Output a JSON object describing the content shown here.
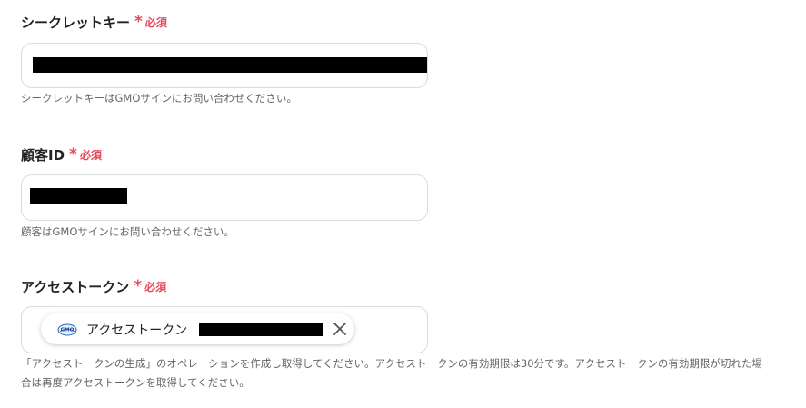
{
  "required_text": "必須",
  "required_marker": "*",
  "fields": {
    "secret_key": {
      "label": "シークレットキー",
      "value": "",
      "help": "シークレットキーはGMOサインにお問い合わせください。"
    },
    "customer_id": {
      "label": "顧客ID",
      "value": "",
      "help": "顧客はGMOサインにお問い合わせください。"
    },
    "access_token": {
      "label": "アクセストークン",
      "chip_label": "アクセストークン",
      "chip_icon": "gmo-logo-icon",
      "help_line1": "「アクセストークンの生成」のオペレーションを作成し取得してください。アクセストークンの有効期限は30分です。アクセストークンの有効期限が切れた場",
      "help_line2": "合は再度アクセストークンを取得してください。"
    }
  },
  "colors": {
    "required": "#e8495b",
    "border": "#d8dbe0",
    "help_text": "#666666",
    "label_text": "#222222"
  }
}
